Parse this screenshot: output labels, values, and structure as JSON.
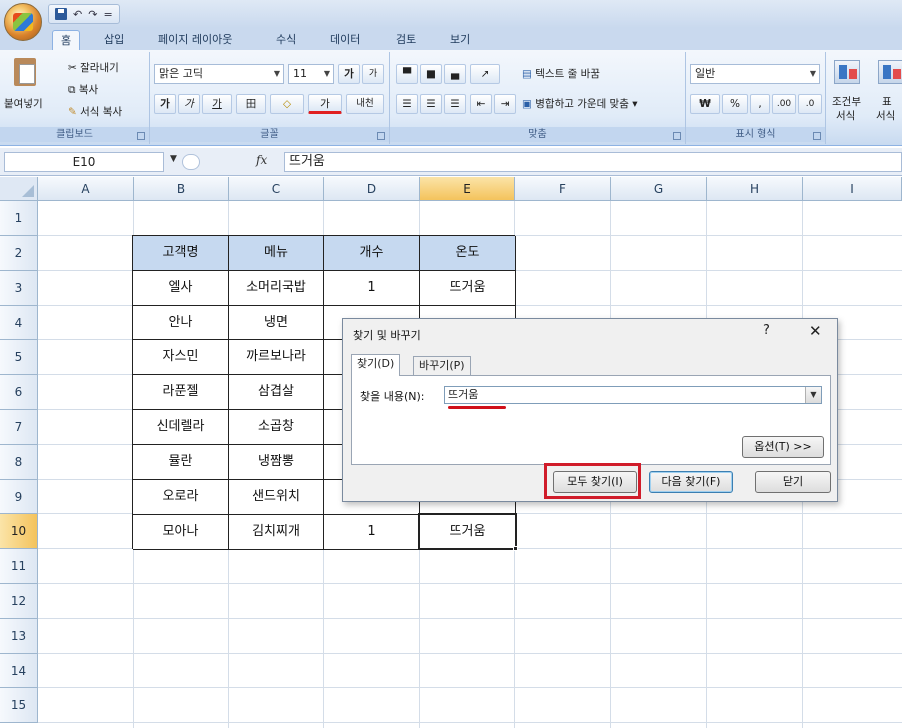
{
  "title_bar": {
    "qat_undo": "↶",
    "qat_redo": "↷",
    "qat_customize": "="
  },
  "tabs": [
    "홈",
    "삽입",
    "페이지 레이아웃",
    "수식",
    "데이터",
    "검토",
    "보기"
  ],
  "ribbon": {
    "clipboard": {
      "paste_label": "붙여넣기",
      "cut_label": "잘라내기",
      "copy_label": "복사",
      "format_painter_label": "서식 복사",
      "group_label": "클립보드"
    },
    "font": {
      "font_name": "맑은 고딕",
      "font_size": "11",
      "grow_label": "가",
      "shrink_label": "가",
      "bold_label": "가",
      "italic_label": "가",
      "underline_label": "가",
      "border_label": "田",
      "fill_label": "◇",
      "font_color_label": "가",
      "phonetic_label": "내천",
      "group_label": "글꼴"
    },
    "alignment": {
      "wrap_text_label": "텍스트 줄 바꿈",
      "merge_label": "병합하고 가운데 맞춤",
      "group_label": "맞춤"
    },
    "number": {
      "format_value": "일반",
      "currency_label": "₩",
      "percent_label": "%",
      "comma_label": ",",
      "inc_decimal_label": ".00",
      "dec_decimal_label": ".0",
      "group_label": "표시 형식"
    },
    "styles": {
      "conditional_label": "조건부",
      "conditional_label2": "서식",
      "table_label": "표",
      "table_label2": "서식"
    }
  },
  "formula_bar": {
    "name_box": "E10",
    "fx_label": "fx",
    "value": "뜨거움"
  },
  "sheet": {
    "columns": [
      "A",
      "B",
      "C",
      "D",
      "E",
      "F",
      "G",
      "H",
      "I"
    ],
    "rows": [
      "1",
      "2",
      "3",
      "4",
      "5",
      "6",
      "7",
      "8",
      "9",
      "10",
      "11",
      "12",
      "13",
      "14",
      "15"
    ],
    "selected_column": "E",
    "selected_row": "10",
    "table": {
      "headers": [
        "고객명",
        "메뉴",
        "개수",
        "온도"
      ],
      "rows": [
        [
          "엘사",
          "소머리국밥",
          "1",
          "뜨거움"
        ],
        [
          "안나",
          "냉면",
          "",
          ""
        ],
        [
          "자스민",
          "까르보나라",
          "",
          ""
        ],
        [
          "라푼젤",
          "삼겹살",
          "",
          ""
        ],
        [
          "신데렐라",
          "소곱창",
          "",
          ""
        ],
        [
          "뮬란",
          "냉짬뽕",
          "",
          ""
        ],
        [
          "오로라",
          "샌드위치",
          "",
          ""
        ],
        [
          "모아나",
          "김치찌개",
          "1",
          "뜨거움"
        ]
      ]
    }
  },
  "dialog": {
    "title": "찾기 및 바꾸기",
    "help": "?",
    "close": "✕",
    "tab_find": "찾기(D)",
    "tab_replace": "바꾸기(P)",
    "find_label": "찾을 내용(N):",
    "find_value": "뜨거움",
    "options_button": "옵션(T) >>",
    "find_all_button": "모두 찾기(I)",
    "find_next_button": "다음 찾기(F)",
    "close_button": "닫기"
  },
  "colors": {
    "highlight": "#d01c2a",
    "table_header_fill": "#c6d9f0",
    "selected_header": "#f4c35c"
  }
}
